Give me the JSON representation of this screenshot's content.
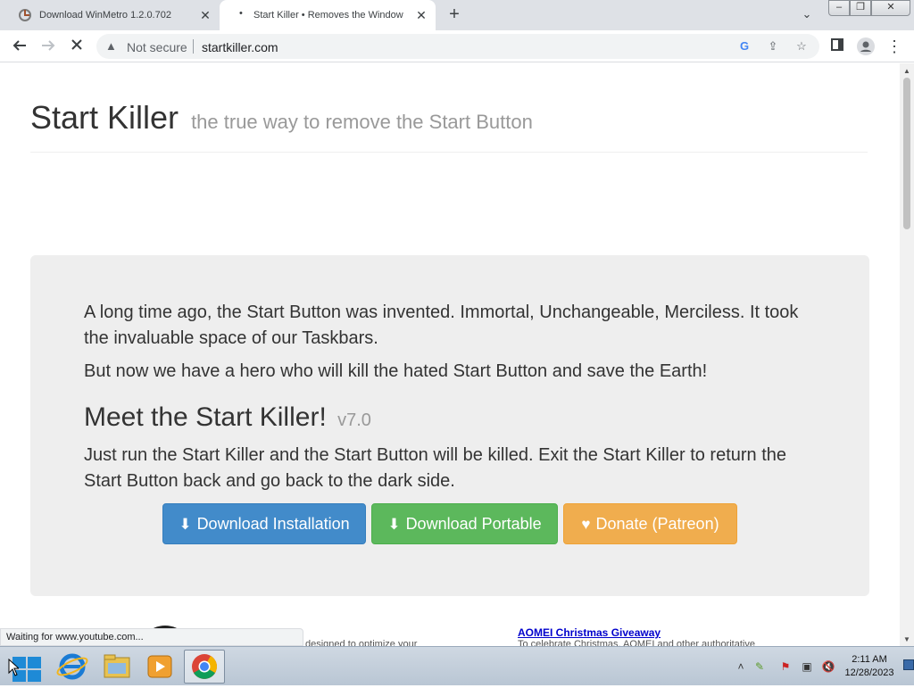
{
  "browser": {
    "tabs": [
      {
        "title": "Download WinMetro 1.2.0.702",
        "active": false
      },
      {
        "title": "Start Killer • Removes the Windows",
        "active": true
      }
    ],
    "new_tab_label": "+",
    "address": {
      "security": "Not secure",
      "url": "startkiller.com"
    },
    "status_text": "Waiting for www.youtube.com..."
  },
  "page": {
    "site_title": "Start Killer",
    "site_tagline": "the true way to remove the Start Button",
    "intro_p1": "A long time ago, the Start Button was invented. Immortal, Unchangeable, Merciless. It took the invaluable space of our Taskbars.",
    "intro_p2": "But now we have a hero who will kill the hated Start Button and save the Earth!",
    "meet_heading": "Meet the Start Killer!",
    "version": "v7.0",
    "intro_p3": "Just run the Start Killer and the Start Button will be killed. Exit the Start Killer to return the Start Button back and go back to the dark side.",
    "buttons": {
      "install": "Download Installation",
      "portable": "Download Portable",
      "donate": "Donate (Patreon)"
    },
    "below_text": "designed to optimize your",
    "aomei_link": "AOMEI Christmas Giveaway",
    "aomei_desc": "To celebrate Christmas, AOMEI and other authoritative"
  },
  "taskbar": {
    "time": "2:11 AM",
    "date": "12/28/2023",
    "icons": [
      "windows-start-icon",
      "internet-explorer-icon",
      "file-explorer-icon",
      "media-player-icon",
      "chrome-icon"
    ]
  },
  "colors": {
    "primary": "#428bca",
    "success": "#5cb85c",
    "warning": "#f0ad4e",
    "jumbotron": "#eeeeee"
  }
}
